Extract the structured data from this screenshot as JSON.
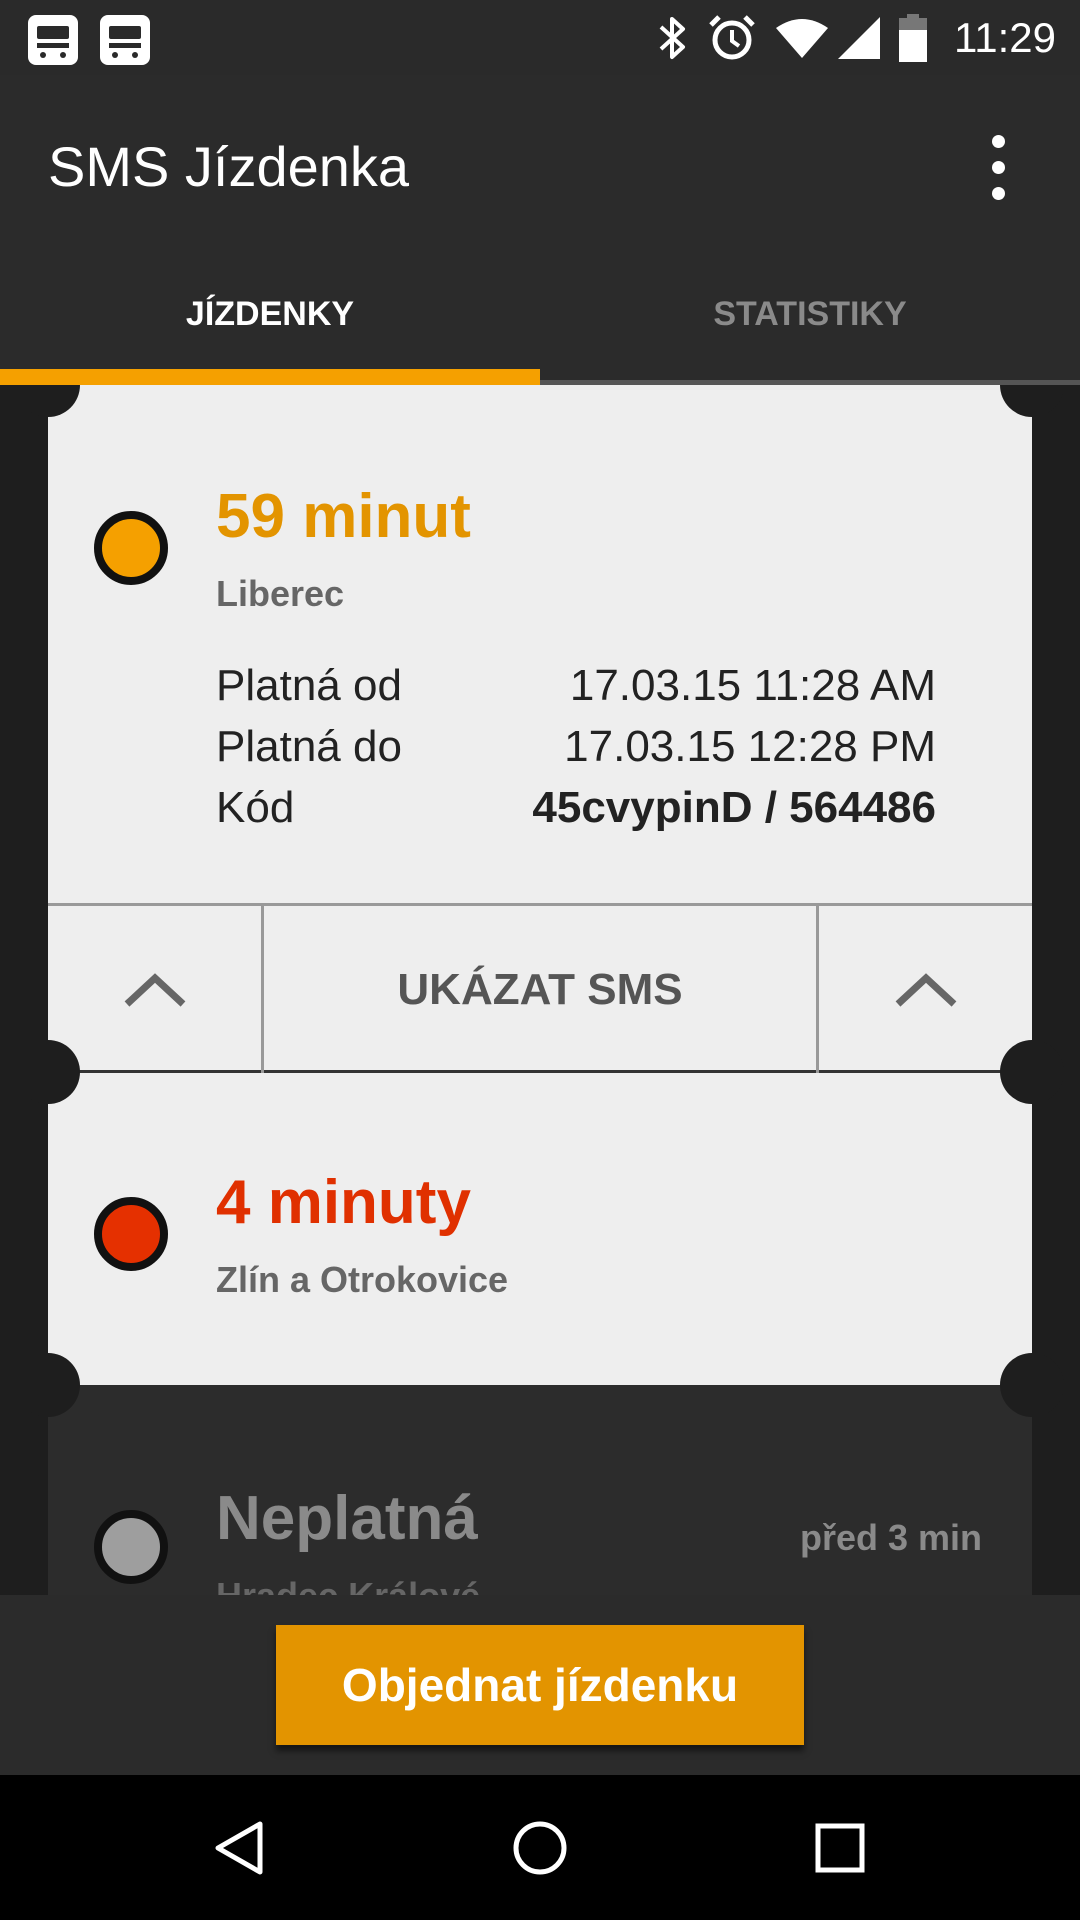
{
  "status_bar": {
    "time": "11:29",
    "left_icons": [
      "bus-icon",
      "bus-icon"
    ],
    "right_icons": [
      "bluetooth-icon",
      "alarm-icon",
      "wifi-icon",
      "signal-icon",
      "battery-icon"
    ]
  },
  "app_bar": {
    "title": "SMS Jízdenka",
    "overflow_icon": "more-vert-icon"
  },
  "tabs": [
    {
      "label": "JÍZDENKY",
      "active": true
    },
    {
      "label": "STATISTIKY",
      "active": false
    }
  ],
  "tickets": [
    {
      "title": "59 minut",
      "city": "Liberec",
      "status_color": "#f5a000",
      "title_color": "#e39400",
      "rows": [
        {
          "key": "Platná od",
          "value": "17.03.15 11:28 AM"
        },
        {
          "key": "Platná do",
          "value": "17.03.15 12:28 PM"
        },
        {
          "key": "Kód",
          "value": "45cvypinD / 564486"
        }
      ],
      "action_label": "UKÁZAT SMS"
    },
    {
      "title": "4 minuty",
      "city": "Zlín a Otrokovice",
      "status_color": "#e53000",
      "title_color": "#e03000"
    },
    {
      "title": "Neplatná",
      "city": "Hradec Králové",
      "ago": "před 3 min",
      "status_color": "#9e9e9e",
      "title_color": "#8a8a8a"
    }
  ],
  "order_button": {
    "label": "Objednat jízdenku"
  },
  "nav_bar": {
    "icons": [
      "back-icon",
      "home-icon",
      "recents-icon"
    ]
  },
  "colors": {
    "accent": "#f5a000",
    "button": "#e39400",
    "expired": "#e03000"
  }
}
